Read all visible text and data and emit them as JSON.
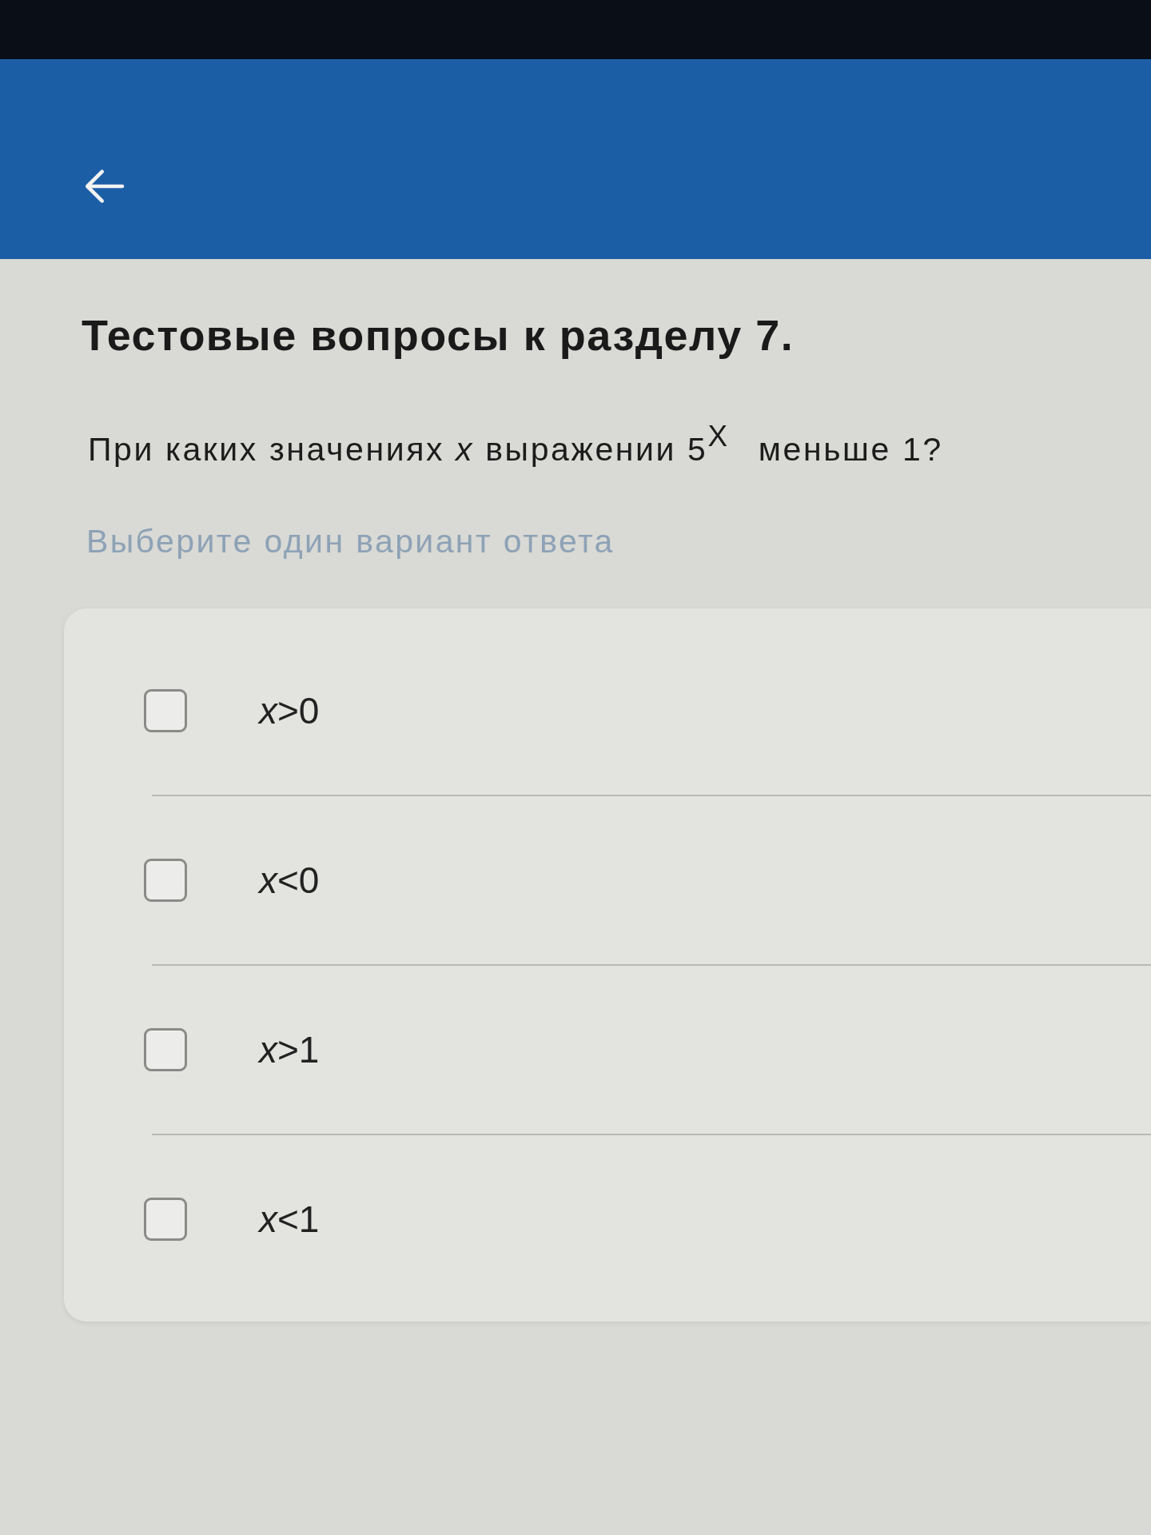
{
  "page": {
    "title": "Тестовые вопросы к разделу 7.",
    "question": "При каких значениях *x* выражении 5$^{X}$ меньше 1?",
    "hint": "Выберите один вариант ответа"
  },
  "options": [
    {
      "kind": "checkbox",
      "label": "*x*>0",
      "checked": false
    },
    {
      "kind": "checkbox",
      "label": "*x*<0",
      "checked": false
    },
    {
      "kind": "checkbox",
      "label": "*x*>1",
      "checked": false
    },
    {
      "kind": "checkbox",
      "label": "*x*<1",
      "checked": false
    }
  ]
}
